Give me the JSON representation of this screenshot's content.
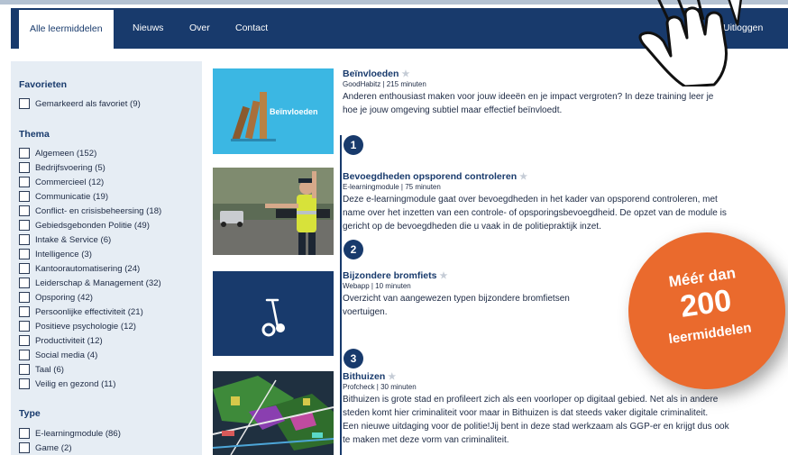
{
  "nav": {
    "tabs": [
      "Alle leermiddelen",
      "Nieuws",
      "Over",
      "Contact"
    ],
    "logout": "Uitloggen"
  },
  "sidebar": {
    "favorites_heading": "Favorieten",
    "favorites": [
      "Gemarkeerd als favoriet (9)"
    ],
    "theme_heading": "Thema",
    "themes": [
      "Algemeen (152)",
      "Bedrijfsvoering (5)",
      "Commercieel (12)",
      "Communicatie (19)",
      "Conflict- en crisisbeheersing (18)",
      "Gebiedsgebonden Politie (49)",
      "Intake & Service (6)",
      "Intelligence (3)",
      "Kantoorautomatisering (24)",
      "Leiderschap & Management (32)",
      "Opsporing (42)",
      "Persoonlijke effectiviteit (21)",
      "Positieve psychologie (12)",
      "Productiviteit (12)",
      "Social media (4)",
      "Taal (6)",
      "Veilig en gezond (11)"
    ],
    "type_heading": "Type",
    "types": [
      "E-learningmodule (86)",
      "Game (2)"
    ]
  },
  "items": [
    {
      "number": "1",
      "title": "Beïnvloeden",
      "meta": "GoodHabitz | 215 minuten",
      "thumb_text": "Beïnvloeden",
      "desc": [
        "Anderen enthousiast maken voor jouw ideeën en je impact vergroten? In deze training leer je",
        "hoe je jouw omgeving subtiel maar effectief beïnvloedt."
      ]
    },
    {
      "number": "2",
      "title": "Bevoegdheden opsporend controleren",
      "meta": "E-learningmodule | 75 minuten",
      "desc": [
        "Deze e-learningmodule gaat over bevoegdheden in het kader van opsporend controleren, met",
        "name over het inzetten van een controle- of opsporingsbevoegdheid. De opzet van de module is",
        "gericht op de bevoegdheden die u vaak in de politiepraktijk inzet."
      ]
    },
    {
      "number": "3",
      "title": "Bijzondere bromfiets",
      "meta": "Webapp | 10 minuten",
      "desc": [
        "Overzicht van aangewezen typen bijzondere bromfietsen",
        "voertuigen."
      ]
    },
    {
      "title": "Bithuizen",
      "meta": "Profcheck | 30 minuten",
      "desc": [
        "Bithuizen is grote stad en profileert zich als een voorloper op digitaal gebied. Net als in andere",
        "steden komt hier criminaliteit voor maar in Bithuizen is dat steeds vaker digitale criminaliteit.",
        "Een nieuwe uitdaging voor de politie!Jij bent in deze stad werkzaam als GGP-er en krijgt dus ook",
        "te maken met deze vorm van criminaliteit."
      ]
    }
  ],
  "badge": {
    "line1": "Méér dan",
    "line2": "200",
    "line3": "leermiddelen"
  },
  "icons": {
    "star": "star-icon",
    "hand": "pointing-hand-icon",
    "segway": "segway-icon"
  },
  "colors": {
    "brand": "#183a6c",
    "sidebar": "#e6edf4",
    "badge": "#ea6a2d",
    "thumb_cyan": "#3bb7e3"
  }
}
